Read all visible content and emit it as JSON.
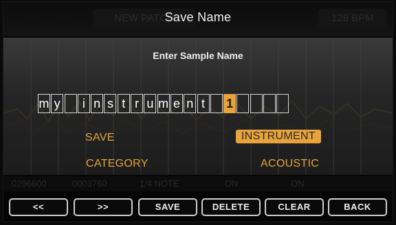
{
  "header": {
    "title": "Save Name",
    "ghost_left": "NEW PATCH",
    "ghost_right": "128 BPM"
  },
  "dialog": {
    "prompt": "Enter Sample Name",
    "name_cells": [
      "m",
      "y",
      " ",
      "i",
      "n",
      "s",
      "t",
      "r",
      "u",
      "m",
      "e",
      "n",
      "t",
      " ",
      "1",
      " ",
      " ",
      " ",
      " "
    ],
    "cursor_index": 14
  },
  "options": {
    "save_label": "SAVE",
    "category_label": "CATEGORY",
    "save_value": "INSTRUMENT",
    "category_value": "ACOUSTIC"
  },
  "status_row": [
    "0296600",
    "0003760",
    "1/4 NOTE",
    "ON",
    "ON"
  ],
  "softkeys": {
    "prev": "<<",
    "next": ">>",
    "save": "SAVE",
    "delete": "DELETE",
    "clear": "CLEAR",
    "back": "BACK"
  },
  "colors": {
    "accent": "#e8a33a",
    "background": "#050505",
    "text": "#f2f2f2"
  }
}
